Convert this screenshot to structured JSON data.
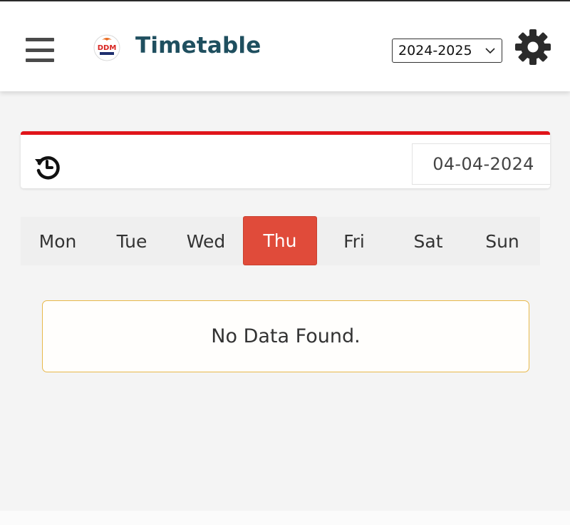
{
  "header": {
    "title": "Timetable",
    "logo_text": "DDM",
    "academic_year": "2024-2025"
  },
  "filter": {
    "date": "04-04-2024"
  },
  "days": [
    "Mon",
    "Tue",
    "Wed",
    "Thu",
    "Fri",
    "Sat",
    "Sun"
  ],
  "selected_day": "Thu",
  "empty_message": "No Data Found.",
  "colors": {
    "accent_red": "#e0141a",
    "active_day": "#e04b3a",
    "title": "#1f4f5f",
    "empty_border": "#e8b84a"
  },
  "icons": {
    "menu": "hamburger-menu-icon",
    "settings": "gear-icon",
    "history": "history-icon",
    "dropdown": "chevron-down-icon"
  }
}
